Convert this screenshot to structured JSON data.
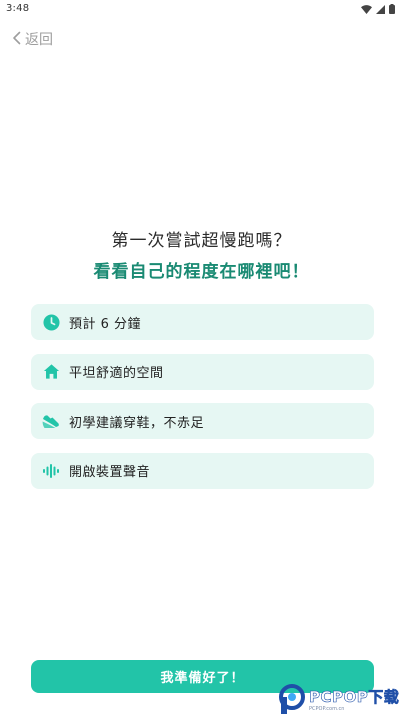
{
  "status_bar": {
    "time": "3:48"
  },
  "nav": {
    "back_label": "返回"
  },
  "content": {
    "title": "第一次嘗試超慢跑嗎？",
    "subtitle": "看看自己的程度在哪裡吧！"
  },
  "features": [
    {
      "icon": "clock-icon",
      "label": "預計 6 分鐘"
    },
    {
      "icon": "home-icon",
      "label": "平坦舒適的空間"
    },
    {
      "icon": "sneaker-icon",
      "label": "初學建議穿鞋，不赤足"
    },
    {
      "icon": "sound-wave-icon",
      "label": "開啟裝置聲音"
    }
  ],
  "primary_button": {
    "label": "我準備好了！"
  },
  "watermark": {
    "text": "PCPOP下载",
    "subtext": "PCPOP.com.cn"
  },
  "colors": {
    "accent": "#22c4a8",
    "accent_dark": "#1a8a73",
    "card_bg": "#e6f7f3",
    "muted": "#9e9e9e",
    "text": "#222222"
  }
}
